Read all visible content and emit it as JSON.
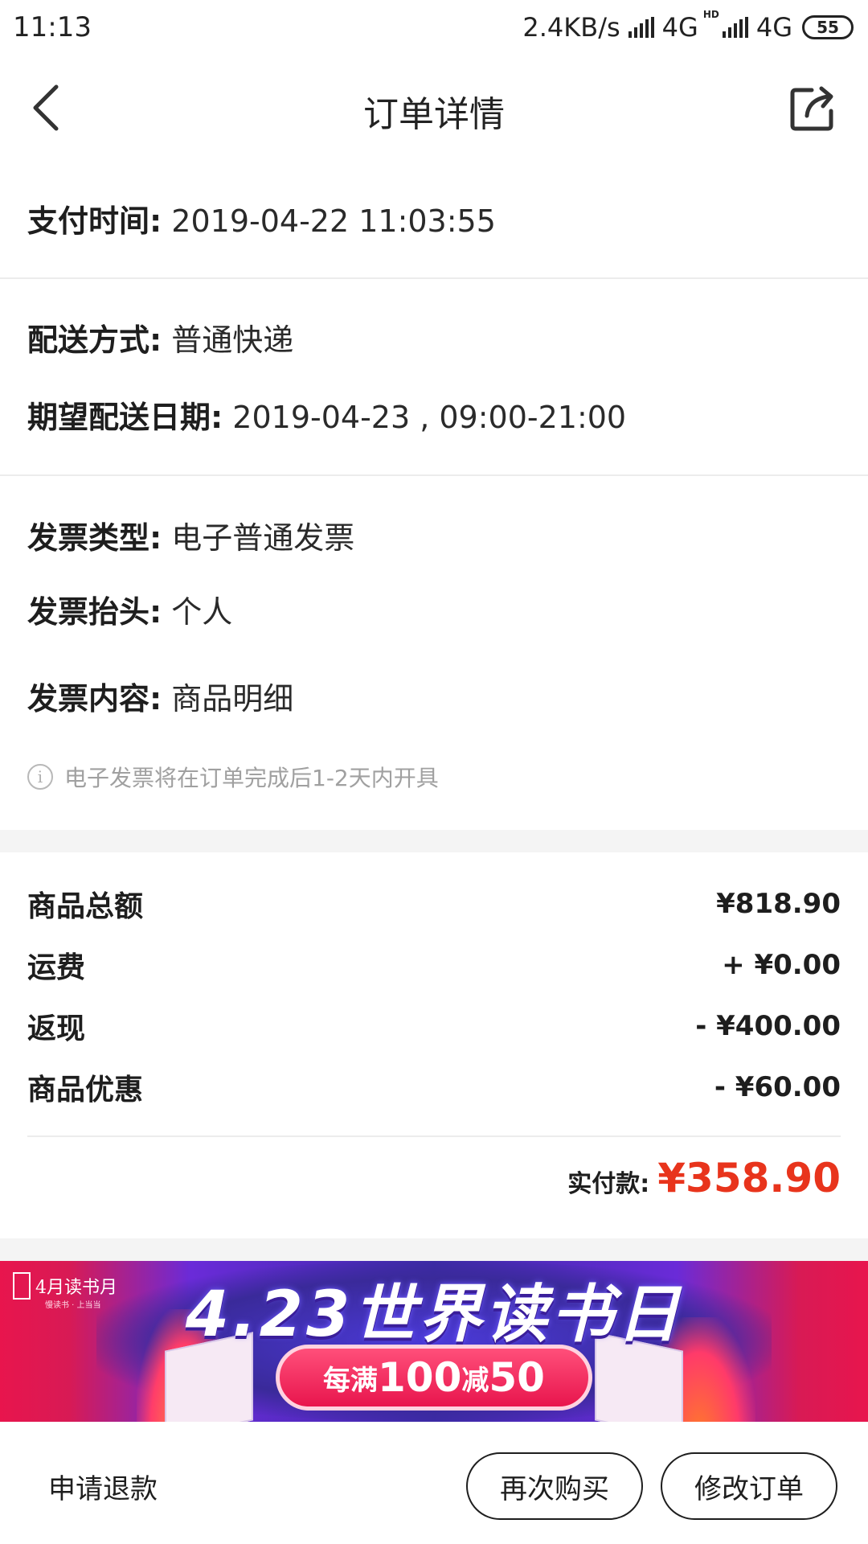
{
  "status_bar": {
    "time": "11:13",
    "speed": "2.4KB/s",
    "net1": "4G",
    "net2": "4G",
    "hd": "HD",
    "battery": "55"
  },
  "header": {
    "title": "订单详情",
    "back_icon": "chevron-left-icon",
    "share_icon": "share-icon"
  },
  "payment": {
    "time_label": "支付时间:",
    "time_value": "2019-04-22 11:03:55"
  },
  "delivery": {
    "method_label": "配送方式:",
    "method_value": "普通快递",
    "date_label": "期望配送日期:",
    "date_value": "2019-04-23 , 09:00-21:00"
  },
  "invoice": {
    "type_label": "发票类型:",
    "type_value": "电子普通发票",
    "title_label": "发票抬头:",
    "title_value": "个人",
    "content_label": "发票内容:",
    "content_value": "商品明细",
    "notice": "电子发票将在订单完成后1-2天内开具",
    "notice_icon": "info-icon"
  },
  "fees": [
    {
      "label": "商品总额",
      "amount": "¥818.90"
    },
    {
      "label": "运费",
      "amount": "+ ¥0.00"
    },
    {
      "label": "返现",
      "amount": "- ¥400.00"
    },
    {
      "label": "商品优惠",
      "amount": "- ¥60.00"
    }
  ],
  "total": {
    "label": "实付款:",
    "amount": "¥358.90",
    "color": "#e8341c"
  },
  "banner": {
    "logo_text": "4月读书月",
    "logo_sub": "慢读书 · 上当当",
    "headline": "4.23世界读书日",
    "promo_prefix": "每满",
    "promo_a": "100",
    "promo_mid": "减",
    "promo_b": "50"
  },
  "footer": {
    "refund": "申请退款",
    "rebuy": "再次购买",
    "modify": "修改订单"
  }
}
